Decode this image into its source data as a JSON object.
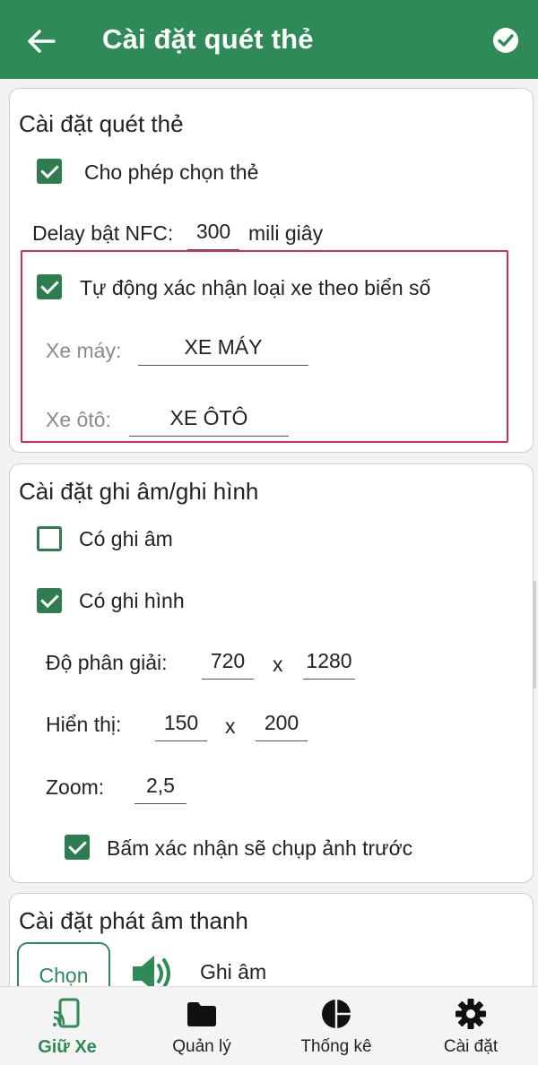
{
  "appbar": {
    "title": "Cài đặt quét thẻ"
  },
  "card_scan": {
    "title": "Cài đặt quét thẻ",
    "allow_select_label": "Cho phép chọn thẻ",
    "delay_label": "Delay bật NFC:",
    "delay_value": "300",
    "delay_unit": "mili giây",
    "auto_detect_label": "Tự động xác nhận loại xe theo biển số",
    "motorbike_label": "Xe máy:",
    "motorbike_value": "XE MÁY",
    "car_label": "Xe ôtô:",
    "car_value": "XE ÔTÔ"
  },
  "card_record": {
    "title": "Cài đặt ghi âm/ghi hình",
    "audio_label": "Có ghi âm",
    "video_label": "Có ghi hình",
    "resolution_label": "Độ phân giải:",
    "resolution_w": "720",
    "resolution_h": "1280",
    "display_label": "Hiển thị:",
    "display_w": "150",
    "display_h": "200",
    "times": "x",
    "zoom_label": "Zoom:",
    "zoom_value": "2,5",
    "capture_before_label": "Bấm xác nhận sẽ chụp ảnh trước"
  },
  "card_sound": {
    "title": "Cài đặt phát âm thanh",
    "choose_label": "Chọn",
    "record_label": "Ghi âm"
  },
  "nav": {
    "items": [
      {
        "label": "Giữ Xe",
        "icon": "nfc-phone-icon"
      },
      {
        "label": "Quản lý",
        "icon": "folder-icon"
      },
      {
        "label": "Thống kê",
        "icon": "pie-chart-icon"
      },
      {
        "label": "Cài đặt",
        "icon": "gear-icon"
      }
    ]
  },
  "colors": {
    "primary": "#2e8b57",
    "checkbox": "#2e7d4f",
    "highlight": "#d32f4f"
  }
}
